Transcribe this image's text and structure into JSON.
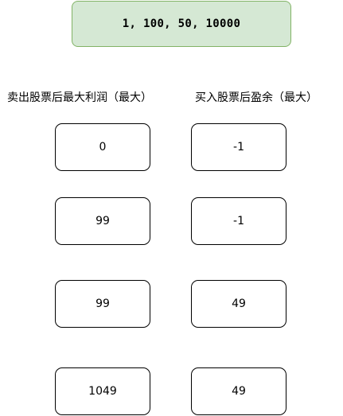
{
  "prices": "1, 100, 50, 10000",
  "headers": {
    "sell": "卖出股票后最大利润（最大）",
    "buy": "买入股票后盈余（最大）"
  },
  "sell_values": [
    "0",
    "99",
    "99",
    "1049"
  ],
  "buy_values": [
    "-1",
    "-1",
    "49",
    "49"
  ],
  "colors": {
    "prices_fill": "#d5e8d4",
    "prices_border": "#82b366",
    "cell_border": "#000000"
  }
}
